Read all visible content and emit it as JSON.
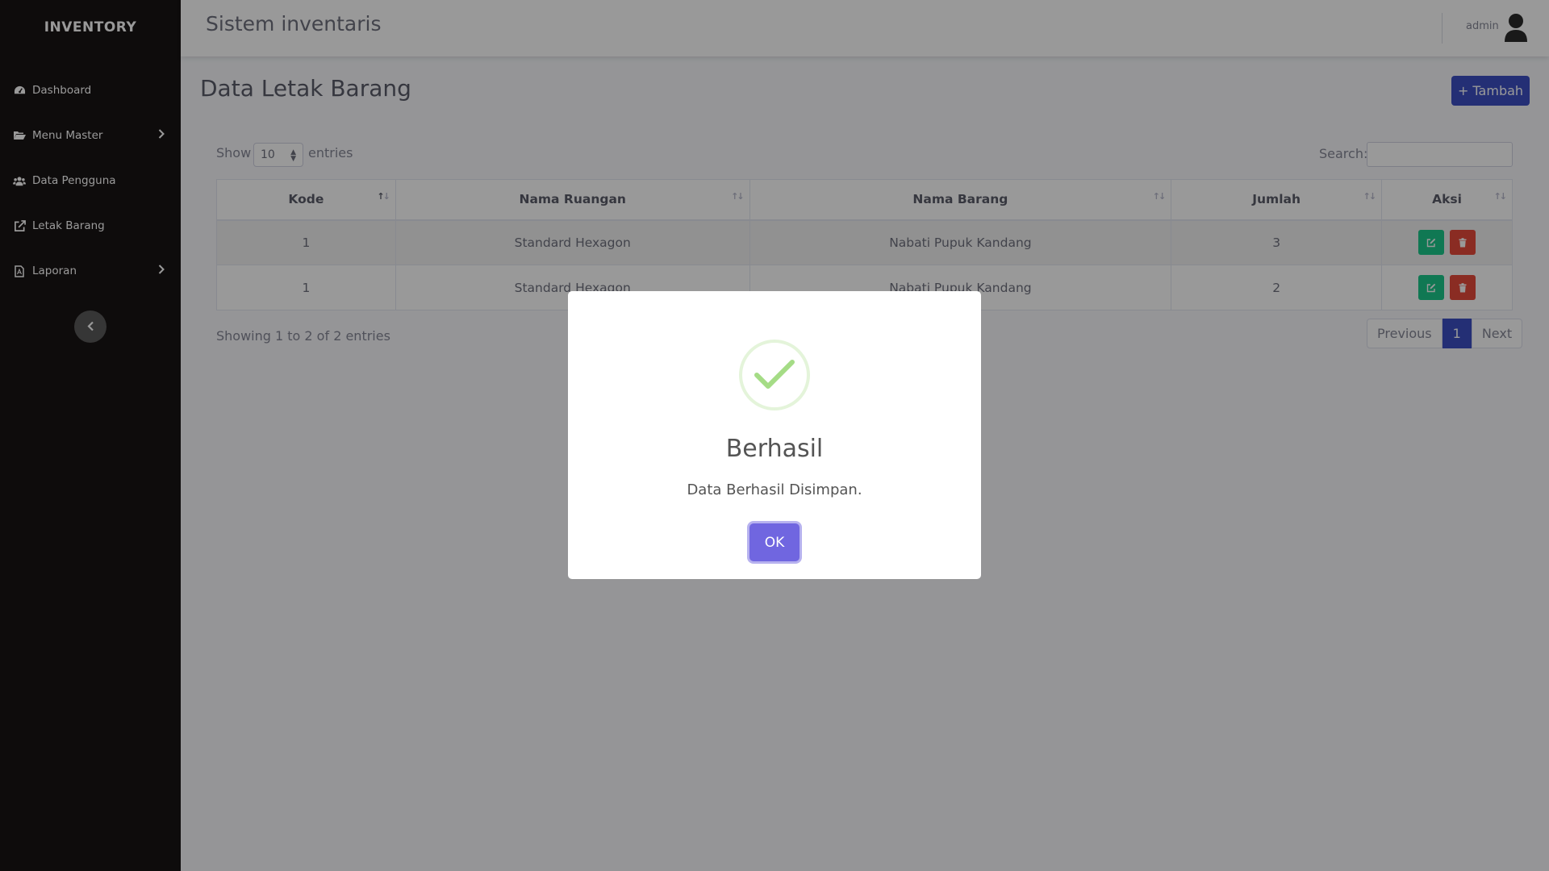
{
  "sidebar": {
    "brand": "INVENTORY",
    "items": [
      {
        "label": "Dashboard",
        "icon": "tachometer-icon"
      },
      {
        "label": "Menu Master",
        "icon": "folder-open-icon",
        "has_submenu": true
      },
      {
        "label": "Data Pengguna",
        "icon": "users-icon"
      },
      {
        "label": "Letak Barang",
        "icon": "external-link-icon"
      },
      {
        "label": "Laporan",
        "icon": "file-pdf-icon",
        "has_submenu": true
      }
    ],
    "toggle_icon": "chevron-left-icon"
  },
  "topbar": {
    "title": "Sistem inventaris",
    "user_name": "admin",
    "user_icon": "user-icon"
  },
  "page": {
    "title": "Data Letak Barang",
    "add_button": "+ Tambah"
  },
  "table_controls": {
    "show_label": "Show",
    "length_value": "10",
    "entries_label": "entries",
    "search_label": "Search:"
  },
  "table": {
    "columns": [
      "Kode",
      "Nama Ruangan",
      "Nama Barang",
      "Jumlah",
      "Aksi"
    ],
    "rows": [
      {
        "kode": "1",
        "ruangan": "Standard Hexagon",
        "barang": "Nabati Pupuk Kandang",
        "jumlah": "3"
      },
      {
        "kode": "1",
        "ruangan": "Standard Hexagon",
        "barang": "Nabati Pupuk Kandang",
        "jumlah": "2"
      }
    ]
  },
  "footer": {
    "info": "Showing 1 to 2 of 2 entries",
    "previous": "Previous",
    "current_page": "1",
    "next": "Next"
  },
  "modal": {
    "title": "Berhasil",
    "text": "Data Berhasil Disimpan.",
    "ok_label": "OK",
    "icon": "success-check-icon"
  },
  "colors": {
    "sidebar_bg": "#181414",
    "primary": "#3d4fc4",
    "success": "#1cc88a",
    "danger": "#e74a3b",
    "confirm": "#7066e0"
  }
}
